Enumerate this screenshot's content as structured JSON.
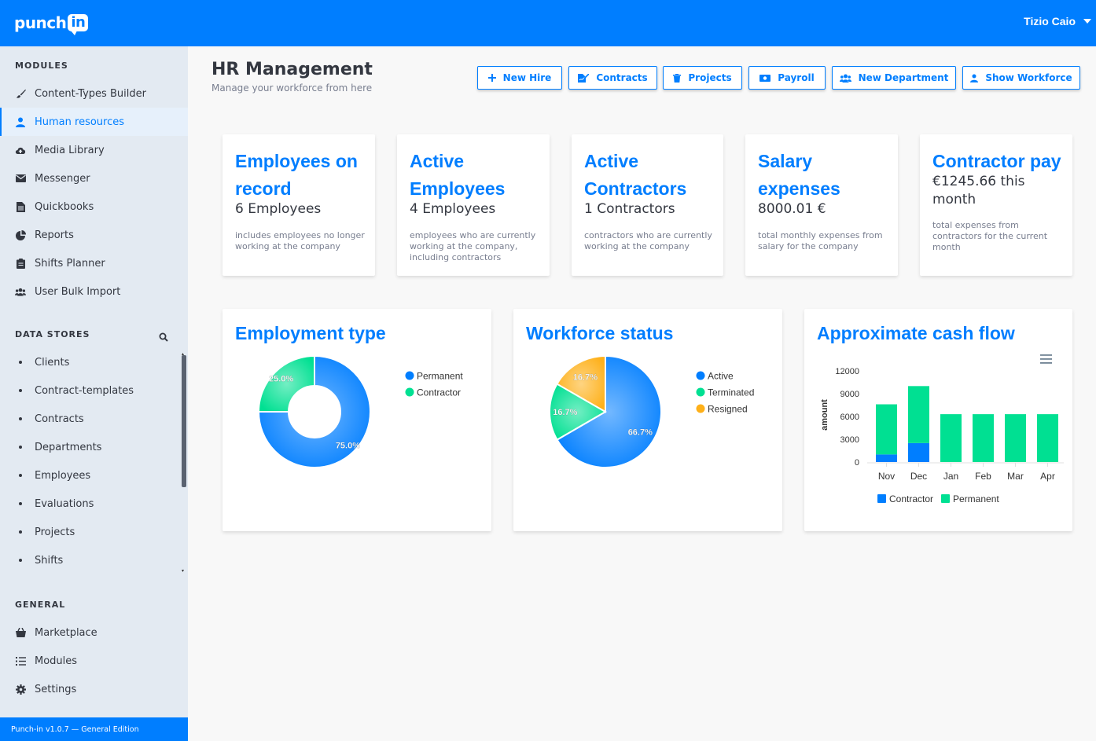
{
  "app": {
    "logo_text": "punch",
    "logo_badge": "in",
    "user_name": "Tizio Caio",
    "version": "Punch-in v1.0.7 — General Edition"
  },
  "colors": {
    "primary": "#007eff",
    "permanent": "#007eff",
    "contractor": "#00e092",
    "resigned": "#feb019"
  },
  "sidebar": {
    "modules_title": "MODULES",
    "modules": [
      {
        "label": "Content-Types Builder",
        "icon": "brush-icon"
      },
      {
        "label": "Human resources",
        "icon": "user-icon"
      },
      {
        "label": "Media Library",
        "icon": "cloud-upload-icon"
      },
      {
        "label": "Messenger",
        "icon": "envelope-icon"
      },
      {
        "label": "Quickbooks",
        "icon": "file-icon"
      },
      {
        "label": "Reports",
        "icon": "pie-chart-icon"
      },
      {
        "label": "Shifts Planner",
        "icon": "clipboard-icon"
      },
      {
        "label": "User Bulk Import",
        "icon": "users-icon"
      }
    ],
    "datastores_title": "DATA STORES",
    "datastores": [
      "Clients",
      "Contract-templates",
      "Contracts",
      "Departments",
      "Employees",
      "Evaluations",
      "Projects",
      "Shifts"
    ],
    "general_title": "GENERAL",
    "general": [
      {
        "label": "Marketplace",
        "icon": "shop-icon"
      },
      {
        "label": "Modules",
        "icon": "list-icon"
      },
      {
        "label": "Settings",
        "icon": "gear-icon"
      }
    ]
  },
  "header": {
    "title": "HR Management",
    "subtitle": "Manage your workforce from here"
  },
  "actions": [
    {
      "label": "New Hire",
      "icon": "plus-icon"
    },
    {
      "label": "Contracts",
      "icon": "signature-icon"
    },
    {
      "label": "Projects",
      "icon": "trash-icon"
    },
    {
      "label": "Payroll",
      "icon": "money-icon"
    },
    {
      "label": "New Department",
      "icon": "users-icon"
    },
    {
      "label": "Show Workforce",
      "icon": "user-icon"
    }
  ],
  "stats": [
    {
      "title": "Employees on record",
      "value": "6 Employees",
      "desc": "includes employees no longer working at the company"
    },
    {
      "title": "Active Employees",
      "value": "4 Employees",
      "desc": "employees who are currently working at the company, including contractors"
    },
    {
      "title": "Active Contractors",
      "value": "1 Contractors",
      "desc": "contractors who are currently working at the company"
    },
    {
      "title": "Salary expenses",
      "value": "8000.01 €",
      "desc": "total monthly expenses from salary for the company"
    },
    {
      "title": "Contractor pay",
      "value": "€1245.66 this month",
      "desc": "total expenses from contractors for the current month"
    }
  ],
  "chart_data": [
    {
      "type": "pie",
      "variant": "donut",
      "title": "Employment type",
      "categories": [
        "Permanent",
        "Contractor"
      ],
      "values": [
        75.0,
        25.0
      ],
      "labels": [
        "75.0%",
        "25.0%"
      ],
      "colors": [
        "#007eff",
        "#00e092"
      ],
      "legend": "right"
    },
    {
      "type": "pie",
      "title": "Workforce status",
      "categories": [
        "Active",
        "Terminated",
        "Resigned"
      ],
      "values": [
        66.7,
        16.7,
        16.7
      ],
      "labels": [
        "66.7%",
        "16.7%",
        "16.7%"
      ],
      "colors": [
        "#007eff",
        "#00e092",
        "#feb019"
      ],
      "legend": "right"
    },
    {
      "type": "bar",
      "stacked": true,
      "title": "Approximate cash flow",
      "ylabel": "amount",
      "categories": [
        "Nov",
        "Dec",
        "Jan",
        "Feb",
        "Mar",
        "Apr"
      ],
      "series": [
        {
          "name": "Contractor",
          "values": [
            1000,
            2500,
            0,
            0,
            0,
            0
          ],
          "color": "#007eff"
        },
        {
          "name": "Permanent",
          "values": [
            6600,
            7500,
            6300,
            6300,
            6300,
            6300
          ],
          "color": "#00e092"
        }
      ],
      "yticks": [
        "0",
        "3000",
        "6000",
        "9000",
        "12000"
      ],
      "ylim": [
        0,
        12000
      ],
      "legend": "bottom",
      "menu_icon": "hamburger-icon"
    }
  ]
}
